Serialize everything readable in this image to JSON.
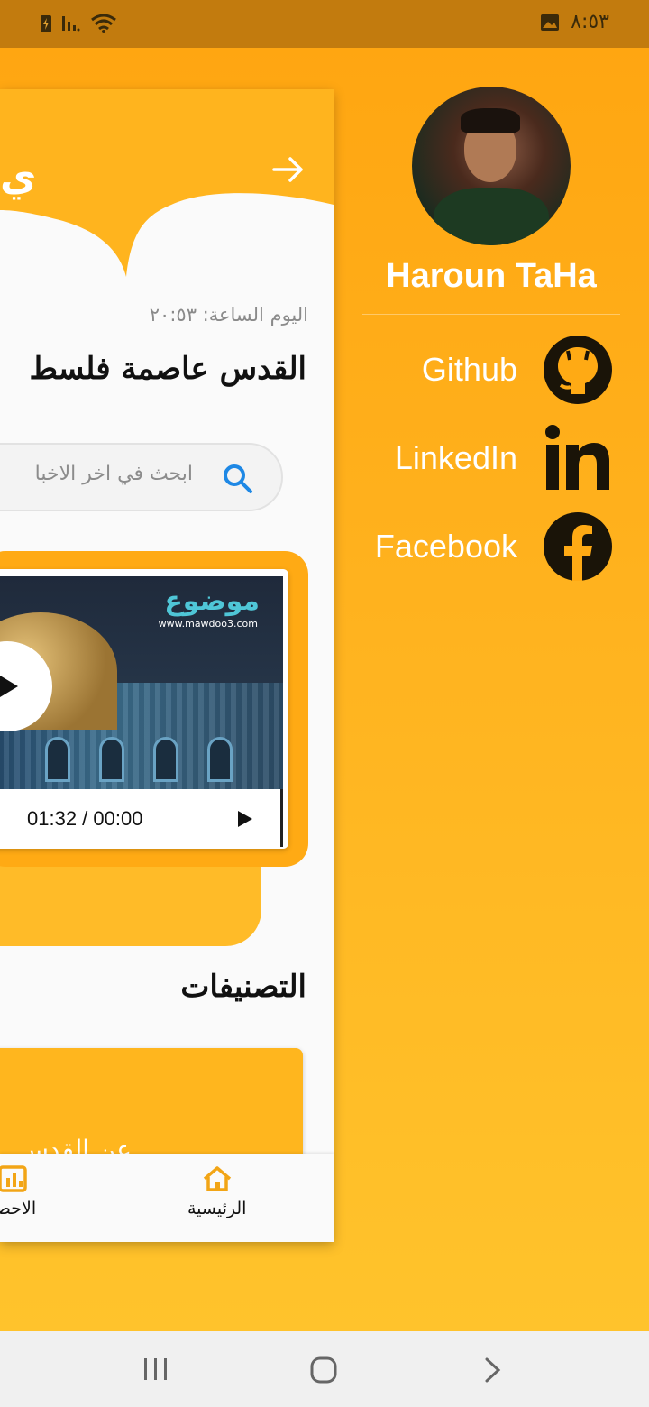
{
  "status_bar": {
    "time": "٨:٥٣",
    "icons": [
      "battery-charging-icon",
      "signal-icon",
      "wifi-icon",
      "gallery-icon"
    ]
  },
  "drawer": {
    "name": "Haroun TaHa",
    "links": [
      {
        "label": "Github",
        "icon": "github-icon"
      },
      {
        "label": "LinkedIn",
        "icon": "linkedin-icon"
      },
      {
        "label": "Facebook",
        "icon": "facebook-icon"
      }
    ]
  },
  "main": {
    "header_partial_title": "ي",
    "time_text": "اليوم الساعة: ٢٠:٥٣",
    "headline": "القدس عاصمة فلسط",
    "search_placeholder": "ابحث في اخر الاخبا",
    "video": {
      "brand": "موضوع",
      "brand_url": "www.mawdoo3.com",
      "timer": "01:32 / 00:00"
    },
    "categories_title": "التصنيفات",
    "category_card_label": "عن القدس"
  },
  "bottom_nav": {
    "items": [
      {
        "label": "الرئيسية",
        "icon": "home-icon"
      },
      {
        "label": "الاحصا",
        "icon": "stats-icon"
      }
    ]
  },
  "colors": {
    "accent": "#FFAA14",
    "drawer_bg_top": "#FFA510",
    "drawer_bg_bottom": "#FFC52D",
    "status_bar": "#C27B0E",
    "icon_dark": "#1A1408"
  }
}
